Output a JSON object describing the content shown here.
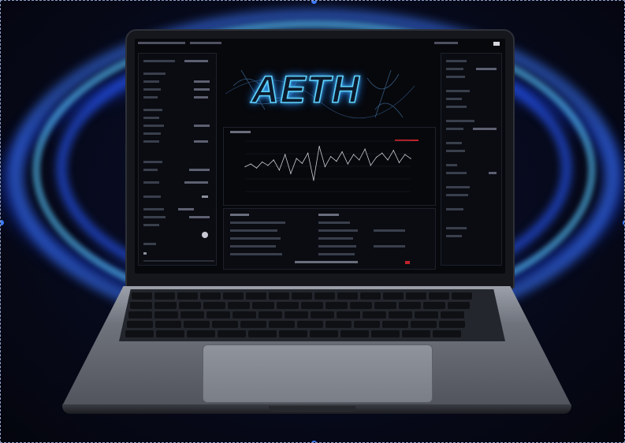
{
  "scene": {
    "subject": "laptop",
    "screen_logo": "AETH",
    "background_color": "#05060f",
    "swirl_colors": [
      "#3c78ff",
      "#5ac8ff",
      "#285aff"
    ]
  },
  "chart_data": {
    "type": "line",
    "x": [
      0,
      1,
      2,
      3,
      4,
      5,
      6,
      7,
      8,
      9,
      10,
      11,
      12,
      13,
      14,
      15,
      16,
      17,
      18,
      19,
      20,
      21,
      22,
      23,
      24,
      25,
      26,
      27,
      28,
      29
    ],
    "series": [
      {
        "values": [
          40,
          44,
          38,
          47,
          42,
          50,
          35,
          58,
          30,
          52,
          45,
          60,
          20,
          70,
          40,
          55,
          48,
          62,
          44,
          58,
          50,
          66,
          42,
          54,
          60,
          50,
          64,
          46,
          58,
          52
        ]
      }
    ]
  }
}
